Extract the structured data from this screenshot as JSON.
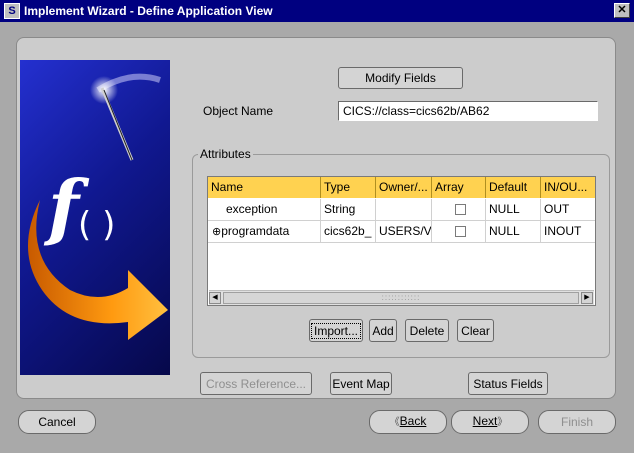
{
  "window": {
    "title": "Implement Wizard - Define Application View",
    "close_glyph": "✕",
    "icon_glyph": "S"
  },
  "image_panel": {
    "glyph_f": "f",
    "glyph_parens": "( )"
  },
  "buttons": {
    "modify_fields": "Modify Fields",
    "import": "Import...",
    "add": "Add",
    "delete": "Delete",
    "clear": "Clear",
    "cross_reference": "Cross Reference...",
    "event_map": "Event Map",
    "status_fields": "Status Fields",
    "cancel": "Cancel",
    "back": "Back",
    "next": "Next",
    "finish": "Finish"
  },
  "object_name": {
    "label": "Object Name",
    "value": "CICS://class=cics62b/AB62"
  },
  "attributes": {
    "group_label": "Attributes",
    "columns": [
      "Name",
      "Type",
      "Owner/...",
      "Array",
      "Default",
      "IN/OU..."
    ],
    "rows": [
      {
        "expand": "",
        "name": "exception",
        "type": "String",
        "owner": "",
        "array": false,
        "default": "NULL",
        "inout": "OUT"
      },
      {
        "expand": "⊕",
        "name": "programdata",
        "type": "cics62b_",
        "owner": "USERS/V",
        "array": false,
        "default": "NULL",
        "inout": "INOUT"
      }
    ],
    "scroll_left": "◀",
    "scroll_right": "▶",
    "scroll_grip": "::::::::::::"
  },
  "arrows": {
    "back": "《",
    "next": "》"
  }
}
